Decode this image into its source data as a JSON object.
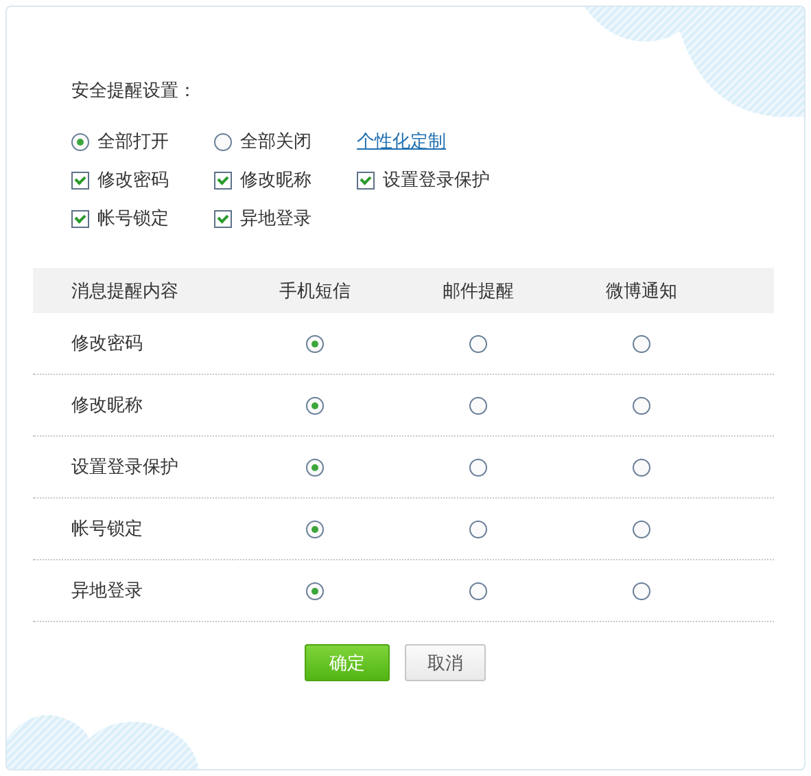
{
  "section_title": "安全提醒设置：",
  "modes": [
    {
      "label": "全部打开",
      "selected": true
    },
    {
      "label": "全部关闭",
      "selected": false
    }
  ],
  "custom_link": "个性化定制",
  "items": [
    {
      "label": "修改密码",
      "checked": true
    },
    {
      "label": "修改昵称",
      "checked": true
    },
    {
      "label": "设置登录保护",
      "checked": true
    },
    {
      "label": "帐号锁定",
      "checked": true
    },
    {
      "label": "异地登录",
      "checked": true
    }
  ],
  "table": {
    "columns": [
      "消息提醒内容",
      "手机短信",
      "邮件提醒",
      "微博通知"
    ],
    "rows": [
      {
        "label": "修改密码",
        "channels": [
          {
            "selected": true
          },
          {
            "selected": false
          },
          {
            "selected": false
          }
        ]
      },
      {
        "label": "修改昵称",
        "channels": [
          {
            "selected": true
          },
          {
            "selected": false
          },
          {
            "selected": false
          }
        ]
      },
      {
        "label": "设置登录保护",
        "channels": [
          {
            "selected": true
          },
          {
            "selected": false
          },
          {
            "selected": false
          }
        ]
      },
      {
        "label": "帐号锁定",
        "channels": [
          {
            "selected": true
          },
          {
            "selected": false
          },
          {
            "selected": false
          }
        ]
      },
      {
        "label": "异地登录",
        "channels": [
          {
            "selected": true
          },
          {
            "selected": false
          },
          {
            "selected": false
          }
        ]
      }
    ]
  },
  "buttons": [
    {
      "label": "确定",
      "kind": "primary"
    },
    {
      "label": "取消",
      "kind": "secondary"
    }
  ]
}
